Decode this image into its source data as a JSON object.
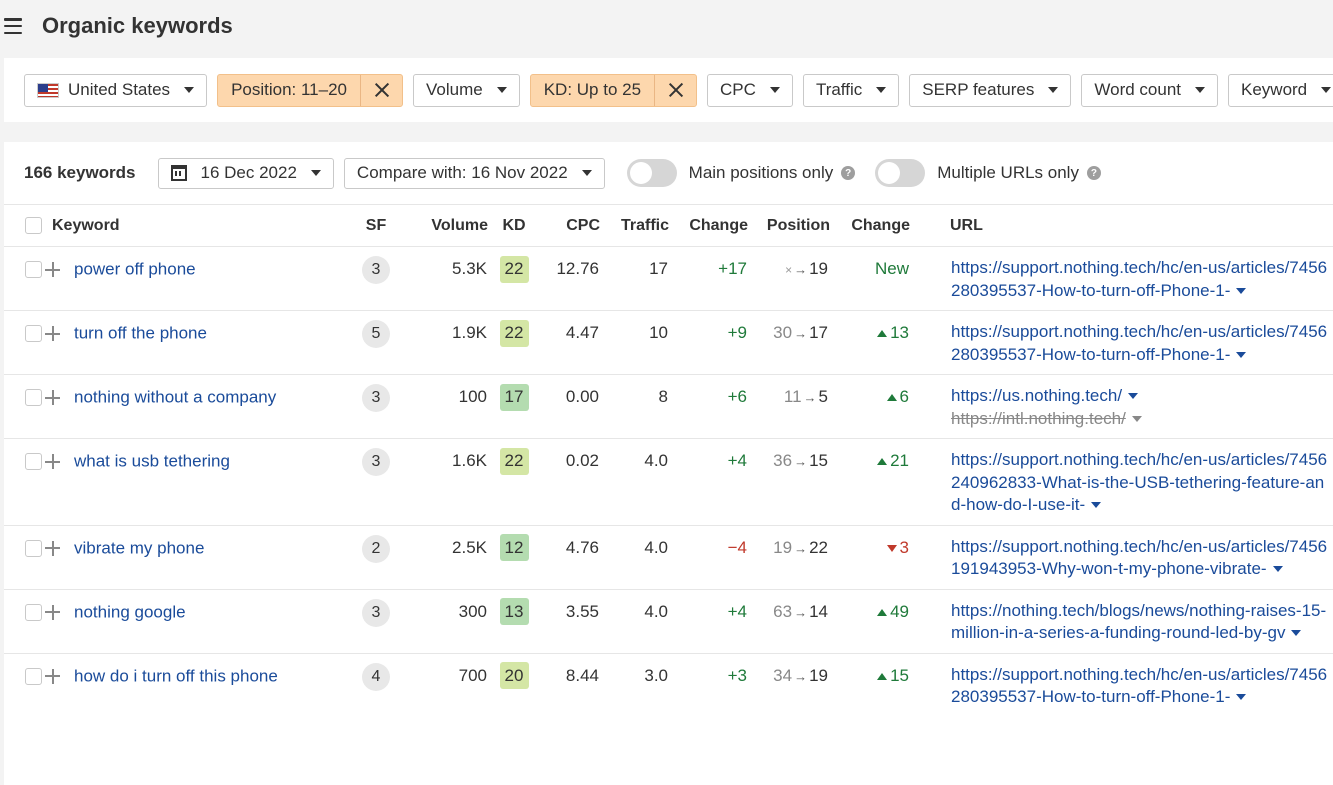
{
  "header": {
    "title": "Organic keywords"
  },
  "filters": [
    {
      "label": "United States",
      "kind": "country",
      "active": false
    },
    {
      "label": "Position: 11–20",
      "active": true
    },
    {
      "label": "Volume",
      "active": false
    },
    {
      "label": "KD: Up to 25",
      "active": true
    },
    {
      "label": "CPC",
      "active": false
    },
    {
      "label": "Traffic",
      "active": false
    },
    {
      "label": "SERP features",
      "active": false
    },
    {
      "label": "Word count",
      "active": false
    },
    {
      "label": "Keyword",
      "active": false
    }
  ],
  "toolbar": {
    "keyword_count": "166 keywords",
    "date": "16 Dec 2022",
    "compare": "Compare with: 16 Nov 2022",
    "toggle_main": "Main positions only",
    "toggle_multi": "Multiple URLs only"
  },
  "table": {
    "headers": {
      "keyword": "Keyword",
      "sf": "SF",
      "volume": "Volume",
      "kd": "KD",
      "cpc": "CPC",
      "traffic": "Traffic",
      "change": "Change",
      "position": "Position",
      "pos_change": "Change",
      "url": "URL"
    },
    "rows": [
      {
        "keyword": "power off phone",
        "sf": "3",
        "volume": "5.3K",
        "kd": "22",
        "kd_color": "#d4e6a5",
        "cpc": "12.76",
        "traffic": "17",
        "traffic_change": "+17",
        "traffic_dir": "up",
        "pos_from": "×",
        "pos_to": "19",
        "pos_change": "New",
        "pos_dir": "new",
        "urls": [
          {
            "text": "https://support.nothing.tech/hc/en-us/articles/7456280395537-How-to-turn-off-Phone-1-",
            "struck": false
          }
        ]
      },
      {
        "keyword": "turn off the phone",
        "sf": "5",
        "volume": "1.9K",
        "kd": "22",
        "kd_color": "#d4e6a5",
        "cpc": "4.47",
        "traffic": "10",
        "traffic_change": "+9",
        "traffic_dir": "up",
        "pos_from": "30",
        "pos_to": "17",
        "pos_change": "13",
        "pos_dir": "up",
        "urls": [
          {
            "text": "https://support.nothing.tech/hc/en-us/articles/7456280395537-How-to-turn-off-Phone-1-",
            "struck": false
          }
        ]
      },
      {
        "keyword": "nothing without a company",
        "sf": "3",
        "volume": "100",
        "kd": "17",
        "kd_color": "#b4dcb0",
        "cpc": "0.00",
        "traffic": "8",
        "traffic_change": "+6",
        "traffic_dir": "up",
        "pos_from": "11",
        "pos_to": "5",
        "pos_change": "6",
        "pos_dir": "up",
        "urls": [
          {
            "text": "https://us.nothing.tech/",
            "struck": false
          },
          {
            "text": "https://intl.nothing.tech/",
            "struck": true
          }
        ]
      },
      {
        "keyword": "what is usb tethering",
        "sf": "3",
        "volume": "1.6K",
        "kd": "22",
        "kd_color": "#d4e6a5",
        "cpc": "0.02",
        "traffic": "4.0",
        "traffic_change": "+4",
        "traffic_dir": "up",
        "pos_from": "36",
        "pos_to": "15",
        "pos_change": "21",
        "pos_dir": "up",
        "urls": [
          {
            "text": "https://support.nothing.tech/hc/en-us/articles/7456240962833-What-is-the-USB-tethering-feature-and-how-do-I-use-it-",
            "struck": false
          }
        ]
      },
      {
        "keyword": "vibrate my phone",
        "sf": "2",
        "volume": "2.5K",
        "kd": "12",
        "kd_color": "#b4dcb0",
        "cpc": "4.76",
        "traffic": "4.0",
        "traffic_change": "−4",
        "traffic_dir": "down",
        "pos_from": "19",
        "pos_to": "22",
        "pos_change": "3",
        "pos_dir": "down",
        "urls": [
          {
            "text": "https://support.nothing.tech/hc/en-us/articles/7456191943953-Why-won-t-my-phone-vibrate-",
            "struck": false
          }
        ]
      },
      {
        "keyword": "nothing google",
        "sf": "3",
        "volume": "300",
        "kd": "13",
        "kd_color": "#b4dcb0",
        "cpc": "3.55",
        "traffic": "4.0",
        "traffic_change": "+4",
        "traffic_dir": "up",
        "pos_from": "63",
        "pos_to": "14",
        "pos_change": "49",
        "pos_dir": "up",
        "urls": [
          {
            "text": "https://nothing.tech/blogs/news/nothing-raises-15-million-in-a-series-a-funding-round-led-by-gv",
            "struck": false
          }
        ]
      },
      {
        "keyword": "how do i turn off this phone",
        "sf": "4",
        "volume": "700",
        "kd": "20",
        "kd_color": "#d4e6a5",
        "cpc": "8.44",
        "traffic": "3.0",
        "traffic_change": "+3",
        "traffic_dir": "up",
        "pos_from": "34",
        "pos_to": "19",
        "pos_change": "15",
        "pos_dir": "up",
        "urls": [
          {
            "text": "https://support.nothing.tech/hc/en-us/articles/7456280395537-How-to-turn-off-Phone-1-",
            "struck": false
          }
        ]
      }
    ]
  }
}
